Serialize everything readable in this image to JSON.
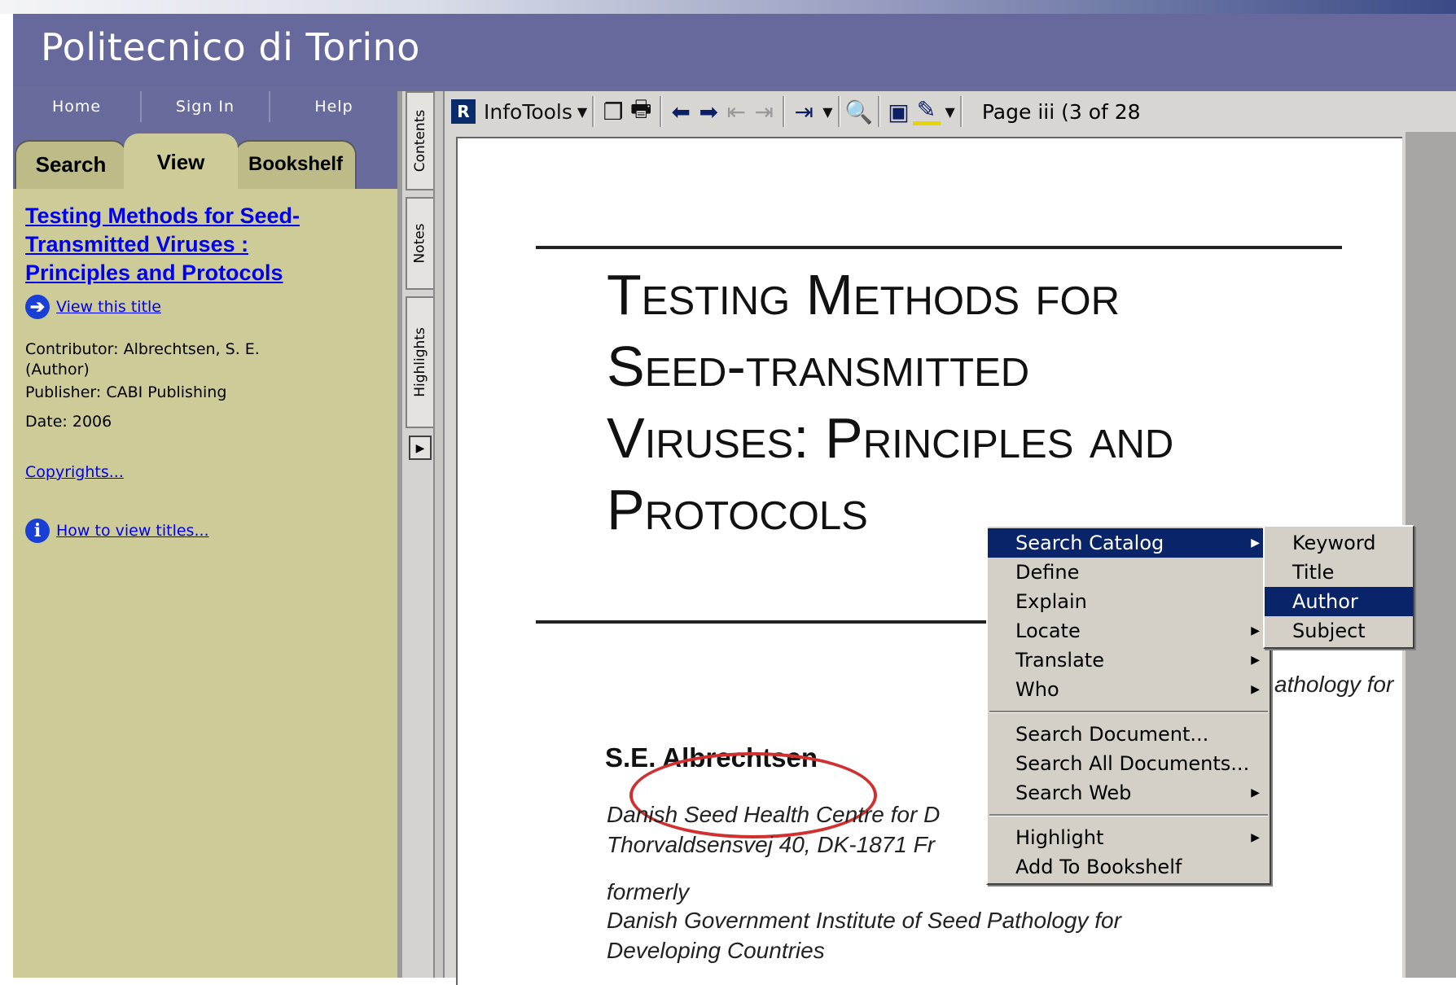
{
  "header": {
    "title": "Politecnico di Torino"
  },
  "nav": {
    "items": [
      "Home",
      "Sign In",
      "Help"
    ]
  },
  "tabs": {
    "search": "Search",
    "view": "View",
    "bookshelf": "Bookshelf"
  },
  "book": {
    "title_line1": "Testing Methods for Seed-",
    "title_line2": "Transmitted Viruses :",
    "title_line3": "Principles and Protocols",
    "view_link": "View this title",
    "contributor_line1": "Contributor: Albrechtsen, S. E.",
    "contributor_line2": "(Author)",
    "publisher": "Publisher: CABI Publishing",
    "date": "Date: 2006",
    "copyrights": "Copyrights...",
    "howto": "How to view titles..."
  },
  "sidetabs": {
    "contents": "Contents",
    "notes": "Notes",
    "highlights": "Highlights"
  },
  "toolbar": {
    "infotools": "InfoTools",
    "page": "Page iii (3 of 28"
  },
  "document": {
    "title_lines": [
      "Testing Methods for",
      "Seed-transmitted",
      "Viruses: Principles and",
      "Protocols"
    ],
    "partial_text": "athology for",
    "author": "S.E. Albrechtsen",
    "affil1": "Danish Seed Health Centre for D",
    "affil2": "Thorvaldsensvej 40, DK-1871 Fr",
    "formerly": "formerly",
    "inst1": "Danish Government Institute of Seed Pathology for",
    "inst2": "Developing Countries"
  },
  "context_menu": {
    "items": [
      "Search Catalog",
      "Define",
      "Explain",
      "Locate",
      "Translate",
      "Who",
      "Search Document...",
      "Search All Documents...",
      "Search Web",
      "Highlight",
      "Add To Bookshelf"
    ],
    "selected": "Search Catalog"
  },
  "submenu": {
    "items": [
      "Keyword",
      "Title",
      "Author",
      "Subject"
    ],
    "selected": "Author"
  }
}
